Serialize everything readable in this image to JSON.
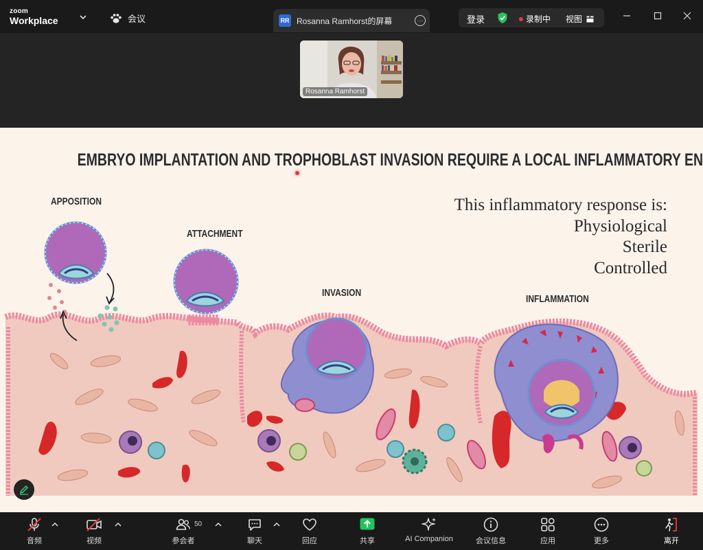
{
  "app": {
    "brand_small": "zoom",
    "brand_name": "Workplace",
    "meeting_label": "会议"
  },
  "share_tab": {
    "badge": "RR",
    "title": "Rosanna Ramhorst的屏幕"
  },
  "header_right": {
    "login": "登录",
    "recording": "录制中",
    "view": "视图"
  },
  "participant": {
    "name": "Rosanna Ramhorst"
  },
  "slide": {
    "title": "EMBRYO IMPLANTATION AND TROPHOBLAST INVASION REQUIRE A LOCAL INFLAMMATORY ENVIRONMENT",
    "stages": [
      "APPOSITION",
      "ATTACHMENT",
      "INVASION",
      "INFLAMMATION"
    ],
    "response_lines": [
      "This inflammatory response is:",
      "Physiological",
      "Sterile",
      "Controlled"
    ]
  },
  "toolbar": {
    "audio": "音频",
    "video": "视频",
    "participants": "参会者",
    "participants_count": "50",
    "chat": "聊天",
    "reactions": "回应",
    "share": "共享",
    "ai_companion": "AI Companion",
    "meeting_info": "会议信息",
    "apps": "应用",
    "more": "更多",
    "leave": "离开"
  },
  "colors": {
    "share_green": "#22c35e",
    "recording_red": "#e23b3b",
    "shield_green": "#27c25a",
    "slide_bg": "#fcf3eb"
  }
}
